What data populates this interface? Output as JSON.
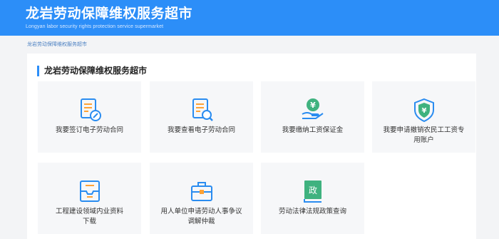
{
  "header": {
    "title": "龙岩劳动保障维权服务超市",
    "subtitle": "Longyan labor security rights protection service supermarket"
  },
  "breadcrumb": "龙岩劳动保障维权服务超市",
  "section": {
    "title": "龙岩劳动保障维权服务超市"
  },
  "services": [
    {
      "label": "我要签订电子劳动合同",
      "icon": "contract-sign-icon"
    },
    {
      "label": "我要查看电子劳动合同",
      "icon": "contract-search-icon"
    },
    {
      "label": "我要缴纳工资保证金",
      "icon": "wage-deposit-icon"
    },
    {
      "label": "我要申请撤销农民工工资专用账户",
      "icon": "shield-yuan-icon"
    },
    {
      "label": "工程建设领域内业资料下载",
      "icon": "download-tray-icon"
    },
    {
      "label": "用人单位申请劳动人事争议调解仲裁",
      "icon": "briefcase-icon"
    },
    {
      "label": "劳动法律法规政策查询",
      "icon": "policy-book-icon"
    }
  ],
  "colors": {
    "header": "#2c8ef8",
    "accent": "#2c8ef8",
    "icon": "#2a8cf0",
    "icon_orange": "#ffa235"
  }
}
